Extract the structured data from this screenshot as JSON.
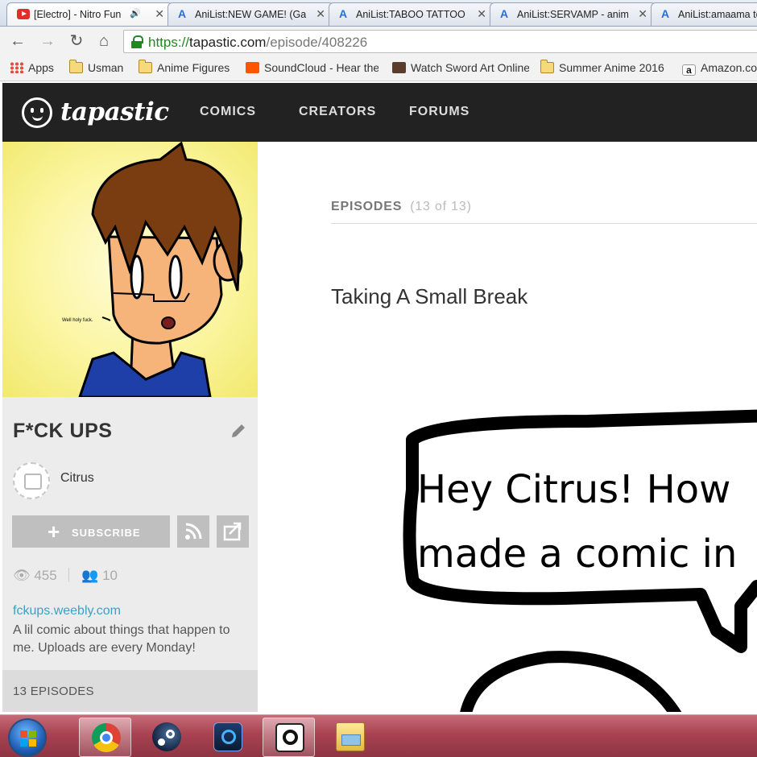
{
  "browser": {
    "tabs": [
      {
        "icon": "youtube-icon",
        "title": "[Electro] - Nitro Fun",
        "has_speaker": true
      },
      {
        "icon": "anilist-icon",
        "title": "AniList:NEW GAME! (Gam"
      },
      {
        "icon": "anilist-icon",
        "title": "AniList:TABOO TATTOO"
      },
      {
        "icon": "anilist-icon",
        "title": "AniList:SERVAMP - anim"
      },
      {
        "icon": "anilist-icon",
        "title": "AniList:amaama to"
      }
    ],
    "url": {
      "scheme": "https://",
      "host": "tapastic.com",
      "path": "/episode/408226"
    },
    "bookmarks": [
      {
        "icon": "apps",
        "label": "Apps"
      },
      {
        "icon": "folder",
        "label": "Usman"
      },
      {
        "icon": "folder",
        "label": "Anime Figures"
      },
      {
        "icon": "soundcloud",
        "label": "SoundCloud - Hear the"
      },
      {
        "icon": "sao",
        "label": "Watch Sword Art Online"
      },
      {
        "icon": "folder",
        "label": "Summer Anime 2016"
      },
      {
        "icon": "amazon",
        "label": "Amazon.com"
      }
    ]
  },
  "site": {
    "logo": "tapastic",
    "nav": [
      "COMICS",
      "CREATORS",
      "FORUMS"
    ]
  },
  "series": {
    "title": "F*CK UPS",
    "cover_caption": "Well holy fuck.",
    "author": "Citrus",
    "subscribe_label": "SUBSCRIBE",
    "views": "455",
    "subscribers": "10",
    "website": "fckups.weebly.com",
    "description": "A lil comic about things that happen to me. Uploads are every Monday!",
    "episode_count_label": "13 EPISODES"
  },
  "episode": {
    "section_label": "EPISODES",
    "section_count": "(13 of 13)",
    "title": "Taking A Small Break",
    "bubble_line1": "Hey Citrus! How",
    "bubble_line2": "made a comic in"
  },
  "taskbar": {
    "apps": [
      "chrome",
      "steam",
      "battle-net",
      "tapastic",
      "file-explorer"
    ]
  },
  "colors": {
    "header_bg": "#222222",
    "link": "#3aa1c9",
    "taskbar": "#a84352"
  }
}
